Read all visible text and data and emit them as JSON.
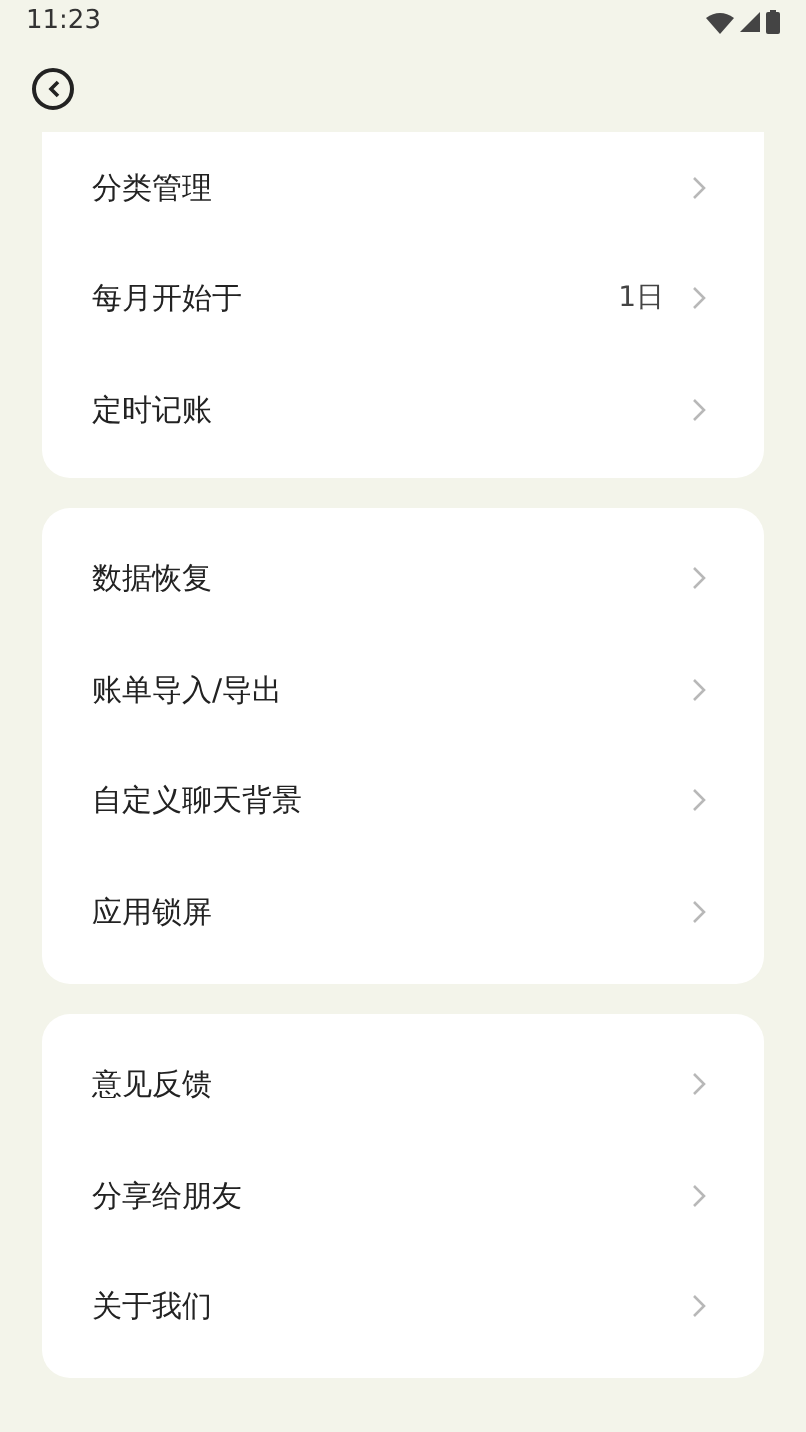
{
  "status_bar": {
    "time": "11:23"
  },
  "groups": [
    {
      "cut_top": true,
      "items": [
        {
          "label": "分类管理"
        },
        {
          "label": "每月开始于",
          "value": "1日"
        },
        {
          "label": "定时记账"
        }
      ]
    },
    {
      "cut_top": false,
      "items": [
        {
          "label": "数据恢复"
        },
        {
          "label": "账单导入/导出"
        },
        {
          "label": "自定义聊天背景"
        },
        {
          "label": "应用锁屏"
        }
      ]
    },
    {
      "cut_top": false,
      "items": [
        {
          "label": "意见反馈"
        },
        {
          "label": "分享给朋友"
        },
        {
          "label": "关于我们"
        }
      ]
    }
  ]
}
